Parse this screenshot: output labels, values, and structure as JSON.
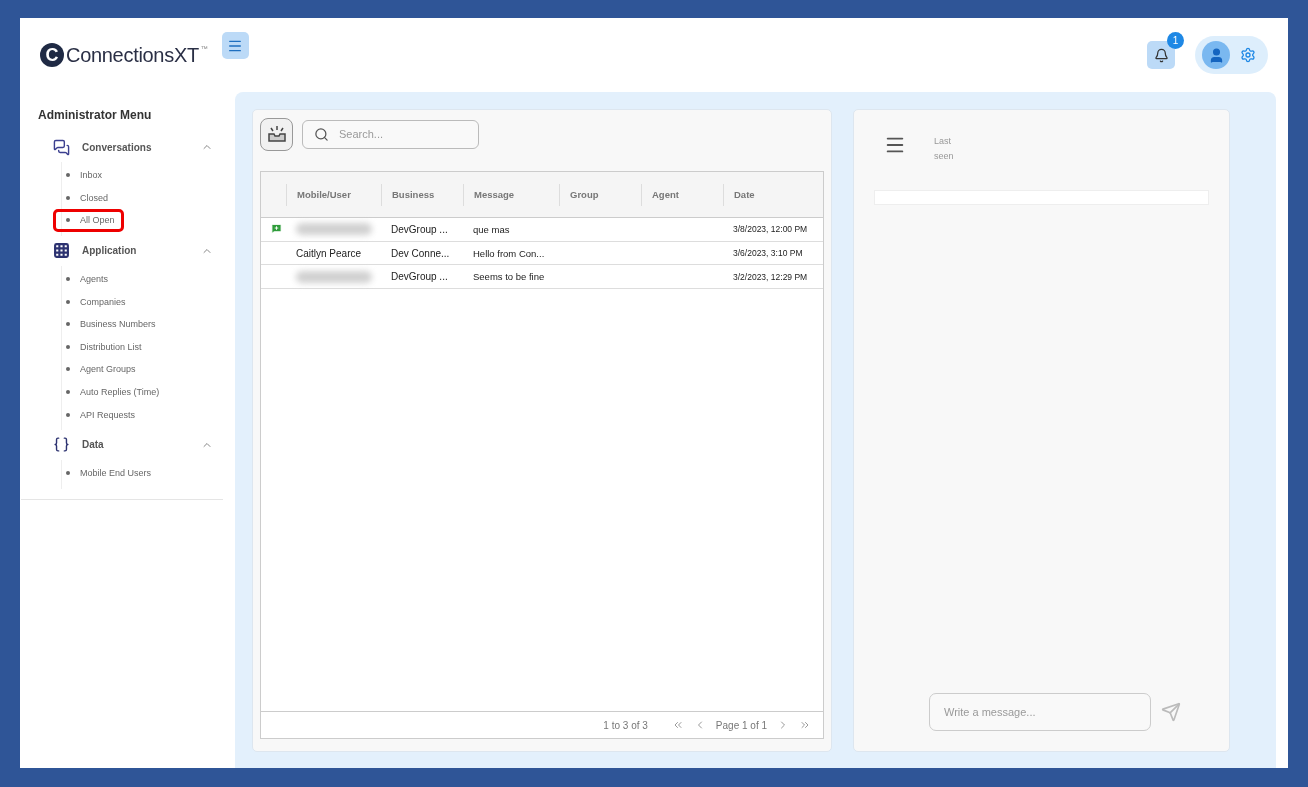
{
  "header": {
    "logo_letter": "C",
    "logo_text": "ConnectionsXT",
    "logo_mark": "™",
    "notifications": "1"
  },
  "sidebar": {
    "title": "Administrator Menu",
    "groups": [
      {
        "label": "Conversations",
        "expanded": true,
        "items": [
          {
            "label": "Inbox",
            "highlighted": false
          },
          {
            "label": "Closed",
            "highlighted": false
          },
          {
            "label": "All Open",
            "highlighted": true
          }
        ]
      },
      {
        "label": "Application",
        "expanded": true,
        "items": [
          {
            "label": "Agents",
            "highlighted": false
          },
          {
            "label": "Companies",
            "highlighted": false
          },
          {
            "label": "Business Numbers",
            "highlighted": false
          },
          {
            "label": "Distribution List",
            "highlighted": false
          },
          {
            "label": "Agent Groups",
            "highlighted": false
          },
          {
            "label": "Auto Replies (Time)",
            "highlighted": false
          },
          {
            "label": "API Requests",
            "highlighted": false
          }
        ]
      },
      {
        "label": "Data",
        "expanded": true,
        "items": [
          {
            "label": "Mobile End Users",
            "highlighted": false
          }
        ]
      }
    ]
  },
  "search": {
    "placeholder": "Search..."
  },
  "table": {
    "columns": [
      "Mobile/User",
      "Business",
      "Message",
      "Group",
      "Agent",
      "Date"
    ],
    "rows": [
      {
        "flagged": true,
        "user_redacted": true,
        "business": "DevGroup ...",
        "message": "que mas",
        "date": "3/8/2023, 12:00 PM"
      },
      {
        "flagged": false,
        "user_redacted": false,
        "user": "Caitlyn Pearce",
        "business": "Dev Conne...",
        "message": "Hello from Con...",
        "date": "3/6/2023, 3:10 PM"
      },
      {
        "flagged": false,
        "user_redacted": true,
        "business": "DevGroup ...",
        "message": "Seems to be fine",
        "date": "3/2/2023, 12:29 PM"
      }
    ]
  },
  "pagination": {
    "summary": "1 to 3 of 3",
    "page": "Page 1 of 1"
  },
  "chat": {
    "status_line1": "Last",
    "status_line2": "seen",
    "placeholder": "Write a message..."
  }
}
